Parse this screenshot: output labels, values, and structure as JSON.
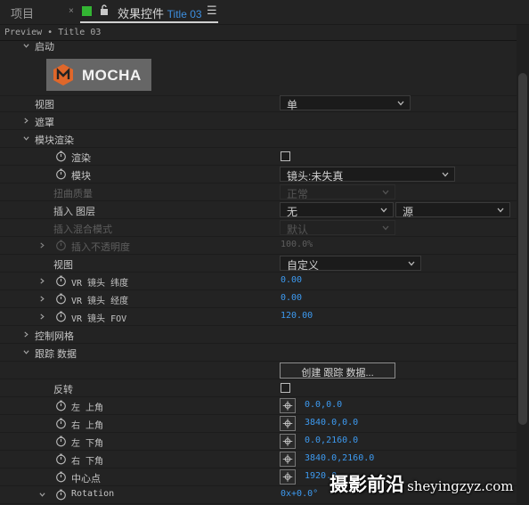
{
  "tabs": {
    "project": "项目",
    "close_glyph": "×",
    "effects_prefix": "效果控件",
    "effects_comp": "Title 03",
    "menu_glyph": "☰"
  },
  "header": {
    "breadcrumb": "Preview • Title 03"
  },
  "logo": {
    "text": "MOCHA"
  },
  "rows": {
    "launch": "启动",
    "view": {
      "label": "视图",
      "value": "单"
    },
    "mask": "遮罩",
    "module_render": "模块渲染",
    "render": {
      "label": "渲染"
    },
    "module": {
      "label": "模块",
      "value": "镜头:未失真"
    },
    "warp_quality": {
      "label": "扭曲质量",
      "value": "正常"
    },
    "insert_layer": {
      "label": "插入 图层",
      "value": "无",
      "source": "源"
    },
    "insert_blend": {
      "label": "插入混合模式",
      "value": "默认"
    },
    "insert_opacity": {
      "label": "插入不透明度",
      "value": "100.0%"
    },
    "view2": {
      "label": "视图",
      "value": "自定义"
    },
    "vr_lat": {
      "label": "VR 镜头 纬度",
      "value": "0.00"
    },
    "vr_lon": {
      "label": "VR 镜头 经度",
      "value": "0.00"
    },
    "vr_fov": {
      "label": "VR 镜头 FOV",
      "value": "120.00"
    },
    "control_grid": "控制网格",
    "tracking_data": "跟踪 数据",
    "create_tracking_button": "创建 跟踪 数据...",
    "invert": {
      "label": "反转"
    },
    "top_left": {
      "label": "左 上角",
      "value": "0.0,0.0"
    },
    "top_right": {
      "label": "右 上角",
      "value": "3840.0,0.0"
    },
    "bottom_left": {
      "label": "左 下角",
      "value": "0.0,2160.0"
    },
    "bottom_right": {
      "label": "右 下角",
      "value": "3840.0,2160.0"
    },
    "center": {
      "label": "中心点",
      "value": "1920.0"
    },
    "rotation": {
      "label": "Rotation",
      "value": "0x+0.0°"
    }
  },
  "watermark": {
    "cn": "摄影前沿",
    "url": "sheyingzyz.com"
  },
  "colors": {
    "accent_blue": "#3d9af0",
    "active_green": "#33b533",
    "panel_bg": "#232323"
  }
}
